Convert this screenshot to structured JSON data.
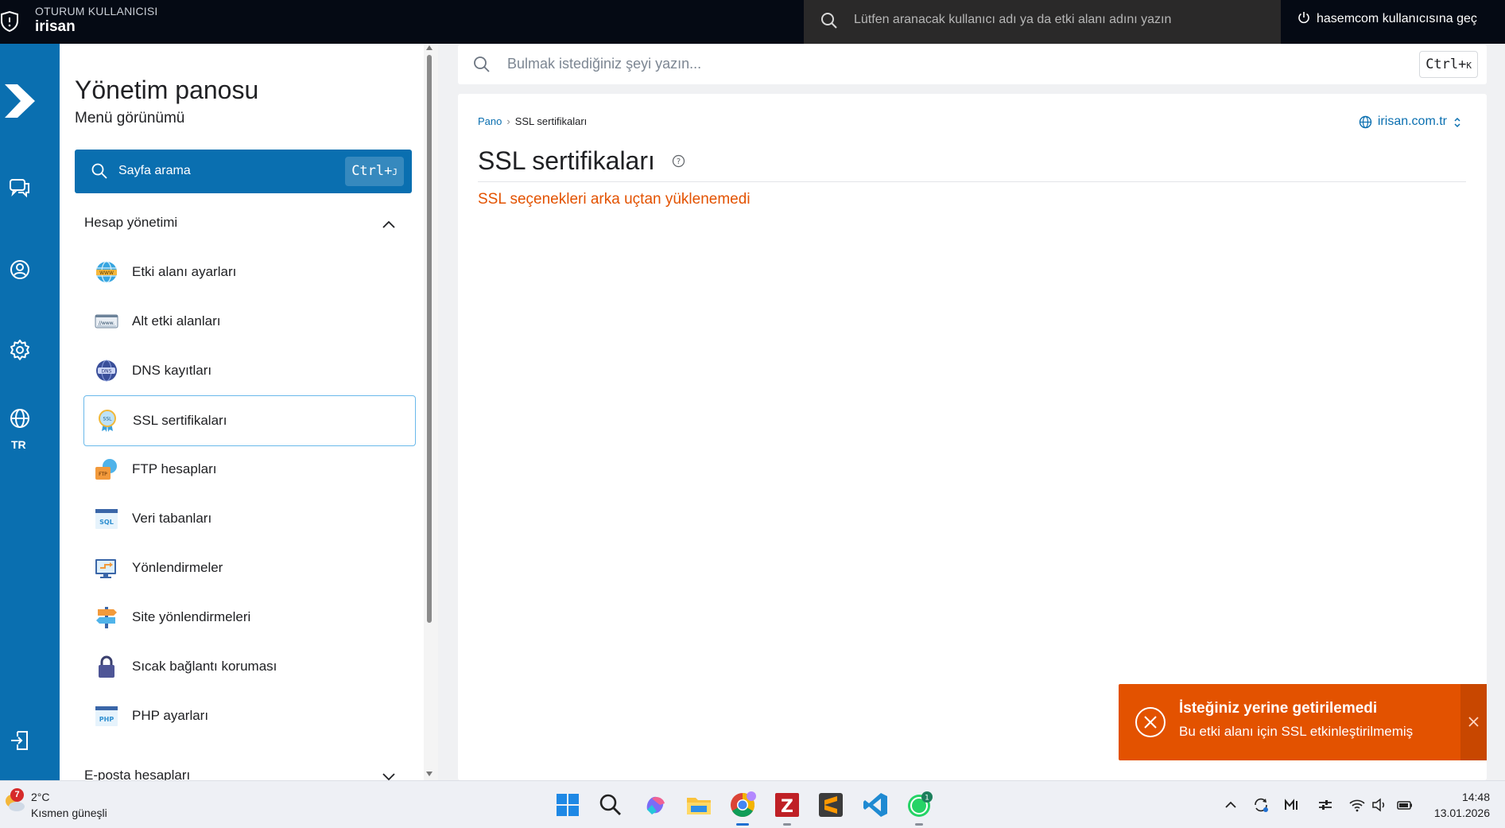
{
  "topbar": {
    "session_label": "OTURUM KULLANICISI",
    "username": "irisan",
    "search_placeholder": "Lütfen aranacak kullanıcı adı ya da etki alanı adını yazın",
    "switch_user": "hasemcom kullanıcısına geç"
  },
  "rail": {
    "language": "TR",
    "icons": [
      "logo-icon",
      "chat-icon",
      "user-icon",
      "gear-icon",
      "globe-icon",
      "logout-icon"
    ]
  },
  "sidebar": {
    "title": "Yönetim panosu",
    "subtitle": "Menü görünümü",
    "search_label": "Sayfa arama",
    "search_kbd": "Ctrl+",
    "search_kbd_key": "J",
    "section": "Hesap yönetimi",
    "items": [
      {
        "label": "Etki alanı ayarları",
        "icon": "www-icon"
      },
      {
        "label": "Alt etki alanları",
        "icon": "subdomain-icon"
      },
      {
        "label": "DNS kayıtları",
        "icon": "dns-icon"
      },
      {
        "label": "SSL sertifikaları",
        "icon": "ssl-icon",
        "active": true
      },
      {
        "label": "FTP hesapları",
        "icon": "ftp-icon"
      },
      {
        "label": "Veri tabanları",
        "icon": "sql-icon"
      },
      {
        "label": "Yönlendirmeler",
        "icon": "redirect-icon"
      },
      {
        "label": "Site yönlendirmeleri",
        "icon": "signpost-icon"
      },
      {
        "label": "Sıcak bağlantı koruması",
        "icon": "lock-icon"
      },
      {
        "label": "PHP ayarları",
        "icon": "php-icon"
      }
    ],
    "next_section": "E-posta hesapları"
  },
  "main": {
    "search_placeholder": "Bulmak istediğiniz şeyi yazın...",
    "search_kbd": "Ctrl+",
    "search_kbd_key": "K",
    "breadcrumb": {
      "home": "Pano",
      "current": "SSL sertifikaları"
    },
    "domain": "irisan.com.tr",
    "title": "SSL sertifikaları",
    "error": "SSL seçenekleri arka uçtan yüklenemedi"
  },
  "toast": {
    "title": "İsteğiniz yerine getirilemedi",
    "message": "Bu etki alanı için SSL etkinleştirilmemiş"
  },
  "taskbar": {
    "weather_badge": "7",
    "temperature": "2°C",
    "condition": "Kısmen güneşli",
    "time": "14:48",
    "date": "13.01.2026",
    "chrome_badge": "",
    "whatsapp_badge": "1"
  },
  "colors": {
    "brand_blue": "#0a6fb0",
    "error_orange": "#e35200",
    "topbar_bg": "#050a14"
  }
}
